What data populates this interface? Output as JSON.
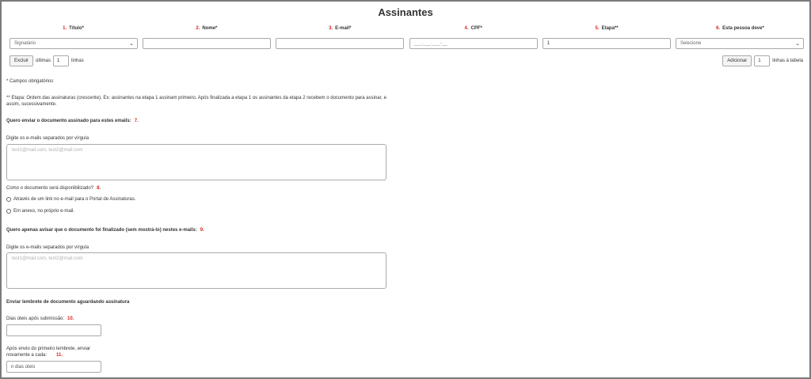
{
  "section_title": "Assinantes",
  "columns": [
    {
      "num": "1.",
      "label": "Título*"
    },
    {
      "num": "2.",
      "label": "Nome*"
    },
    {
      "num": "3.",
      "label": "E-mail*"
    },
    {
      "num": "4.",
      "label": "CPF*"
    },
    {
      "num": "5.",
      "label": "Etapa**"
    },
    {
      "num": "6.",
      "label": "Esta pessoa deve*"
    }
  ],
  "row_inputs": {
    "titulo_value": "Signatário",
    "nome_value": "",
    "email_value": "",
    "cpf_placeholder": "___.___.___-__",
    "etapa_value": "1",
    "deve_value": "Selecione"
  },
  "controls": {
    "excluir_label": "Excluir",
    "ultimas_label": "últimas",
    "excluir_count": "1",
    "linhas_label": "linhas",
    "adicionar_label": "Adicionar",
    "adicionar_count": "1",
    "linhas_tabela_label": "linhas à tabela"
  },
  "notes": {
    "required": "* Campos obrigatórios",
    "etapa_line1": "** Etapa: Ordem das assinaturas (crescente). Ex: assinantes na etapa 1 assinam primeiro. Após finalizada a etapa 1 os assinantes da etapa 2 recebem o documento para assinar, e",
    "etapa_line2": "assim, sucessivamente."
  },
  "send_signed": {
    "heading": "Quero enviar o documento assinado para estes emails:",
    "num": "7.",
    "hint": "Digite os e-mails separados por vírgula",
    "placeholder": "test1@mail.com, test2@mail.com"
  },
  "availability": {
    "question": "Como o documento será disponibilizado?",
    "num": "8.",
    "option1": "Através de um link no e-mail para o Portal de Assinaturas.",
    "option2": "Em anexo, no próprio e-mail."
  },
  "notify_only": {
    "heading": "Quero apenas avisar que o documento foi finalizado (sem mostrá-lo) nestes e-mails:",
    "num": "9.",
    "hint": "Digite os e-mails separados por vírgula",
    "placeholder": "test1@mail.com, test2@mail.com"
  },
  "reminder": {
    "heading": "Enviar lembrete de documento aguardando assinatura",
    "days_label": "Dias úteis após submissão:",
    "days_num": "10.",
    "repeat_label_line1": "Após envio do primeiro lembrete, enviar",
    "repeat_label_line2": "novamente a cada:",
    "repeat_num": "11.",
    "repeat_placeholder": "n dias úteis"
  }
}
